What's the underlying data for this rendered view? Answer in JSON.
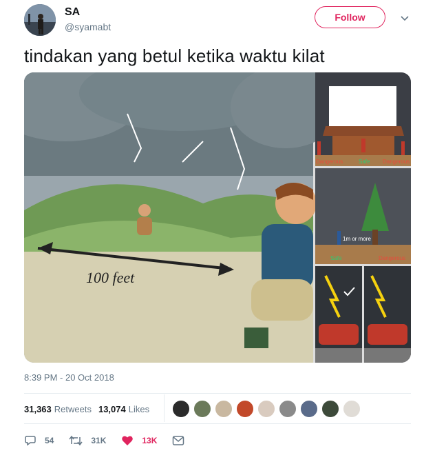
{
  "user": {
    "name": "SA",
    "handle": "@syamabt",
    "follow_label": "Follow"
  },
  "tweet": {
    "text": "tindakan yang betul ketika waktu kilat",
    "timestamp": "8:39 PM - 20 Oct 2018"
  },
  "media": {
    "main_label": "100 feet",
    "house_labels": [
      "Dangerous",
      "Safe",
      "Dangerous"
    ],
    "tree_labels": {
      "distance": "1m or more",
      "safe": "Safe",
      "dangerous": "Dangerous"
    }
  },
  "stats": {
    "retweets_count": "31,363",
    "retweets_label": "Retweets",
    "likes_count": "13,074",
    "likes_label": "Likes"
  },
  "likers": [
    "#2b2b2b",
    "#6b7a5a",
    "#c9b8a0",
    "#c2492a",
    "#d9cbbf",
    "#8a8a8a",
    "#5a6b8a",
    "#3d4a3a",
    "#e0dcd6"
  ],
  "actions": {
    "replies": "54",
    "retweets": "31K",
    "likes": "13K"
  },
  "colors": {
    "accent": "#e0245e",
    "muted": "#657786",
    "text": "#14171a"
  }
}
